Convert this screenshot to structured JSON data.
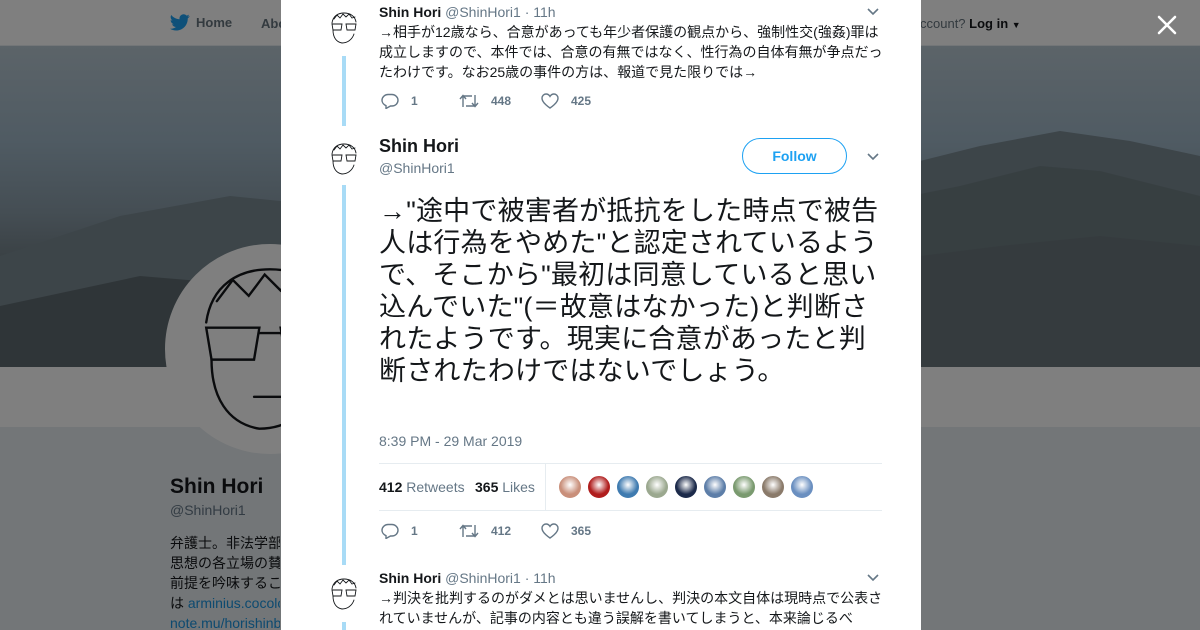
{
  "nav": {
    "home_label": "Home",
    "about_label": "Abo",
    "account_prompt": "ccount?",
    "login_label": "Log in"
  },
  "profile": {
    "name": "Shin Hori",
    "handle": "@ShinHori1",
    "bio_lines": [
      "弁護士。非法学部",
      "思想の各立場の賛",
      "前提を吟味するこ"
    ],
    "bio_link_prefix": "は ",
    "bio_link_1": "arminius.cocolo",
    "bio_link_2": "note.mu/horishinb"
  },
  "prev_tweet": {
    "name": "Shin Hori",
    "handle": "@ShinHori1",
    "time": "11h",
    "text": "→相手が12歳なら、合意があっても年少者保護の観点から、強制性交(強姦)罪は成立しますので、本件では、合意の有無ではなく、性行為の自体有無が争点だったわけです。なお25歳の事件の方は、報道で見た限りでは→",
    "replies": "1",
    "retweets": "448",
    "likes": "425"
  },
  "main_tweet": {
    "name": "Shin Hori",
    "handle": "@ShinHori1",
    "follow_label": "Follow",
    "text": "→\"途中で被害者が抵抗をした時点で被告人は行為をやめた\"と認定されているようで、そこから\"最初は同意していると思い込んでいた\"(＝故意はなかった)と判断されたようです。現実に合意があったと判断されたわけではないでしょう。",
    "timestamp": "8:39 PM - 29 Mar 2019",
    "retweet_count": "412",
    "retweet_label": "Retweets",
    "like_count": "365",
    "like_label": "Likes",
    "liker_colors": [
      "#c98f7a",
      "#b01d1d",
      "#3f7bb0",
      "#9ba88f",
      "#1c2a4a",
      "#5d7ea8",
      "#7a9a6f",
      "#8a7a6a",
      "#6a8fc0"
    ],
    "replies": "1",
    "retweets": "412",
    "likes": "365"
  },
  "next_tweet": {
    "name": "Shin Hori",
    "handle": "@ShinHori1",
    "time": "11h",
    "text": "→判決を批判するのがダメとは思いませんし、判決の本文自体は現時点で公表されていませんが、記事の内容とも違う誤解を書いてしまうと、本来論じるべ"
  },
  "colors": {
    "accent": "#1da1f2",
    "thread_line": "#a8dbf6",
    "muted_text": "#657786"
  },
  "icons": {
    "nav_logo": "twitter-bird-icon",
    "close": "close-icon",
    "reply": "reply-icon",
    "retweet": "retweet-icon",
    "like": "heart-icon",
    "caret": "chevron-down-icon"
  }
}
